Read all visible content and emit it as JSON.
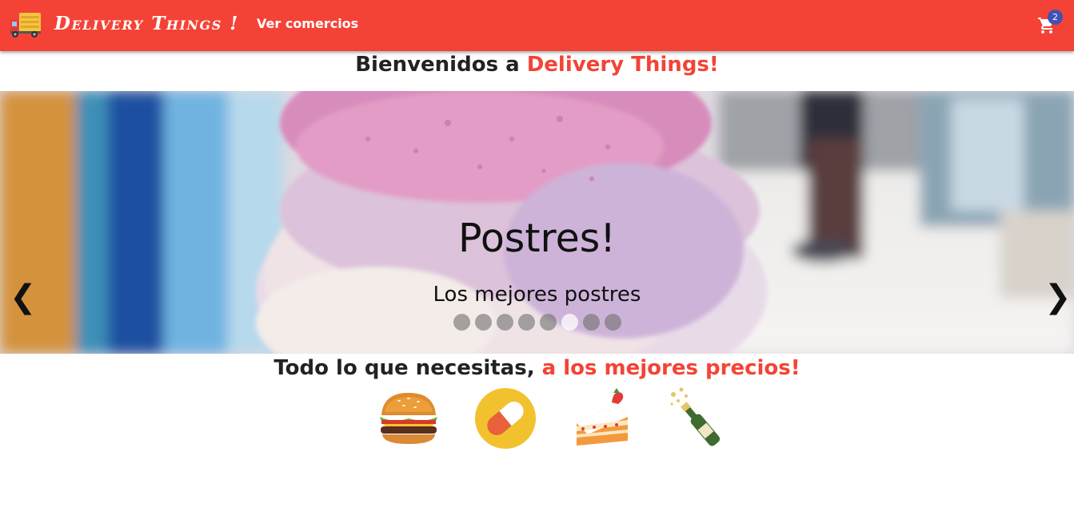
{
  "header": {
    "brand": "Delivery Things !",
    "nav_link": "Ver comercios",
    "cart_count": "2",
    "logo_icon": "delivery-truck-icon",
    "cart_icon": "shopping-cart-icon"
  },
  "welcome": {
    "prefix": "Bienvenidos a ",
    "highlight": "Delivery Things!"
  },
  "carousel": {
    "title": "Postres!",
    "subtitle": "Los mejores postres",
    "prev_icon": "chevron-left-icon",
    "next_icon": "chevron-right-icon",
    "prev": "❮",
    "next": "❯",
    "slide_count": 8,
    "active_index": 5
  },
  "tagline": {
    "prefix": "Todo lo que necesitas, ",
    "highlight": "a los mejores precios!"
  },
  "categories": [
    {
      "icon": "hamburger-icon"
    },
    {
      "icon": "pill-icon"
    },
    {
      "icon": "cake-icon"
    },
    {
      "icon": "champagne-icon"
    }
  ],
  "colors": {
    "primary": "#f44336",
    "badge": "#3f51b5"
  }
}
